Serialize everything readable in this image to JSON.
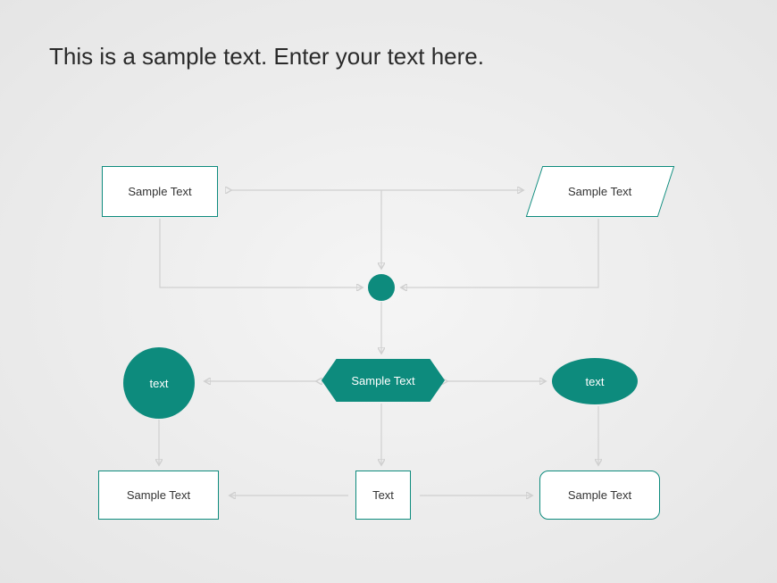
{
  "title": "This is a sample text. Enter your text here.",
  "nodes": {
    "top_left_rect": "Sample Text",
    "top_right_para": "Sample Text",
    "center_circle": "",
    "left_circle": "text",
    "center_hex": "Sample Text",
    "right_ellipse": "text",
    "bottom_left_rect": "Sample Text",
    "bottom_mid_rect": "Text",
    "bottom_right_rrect": "Sample Text"
  },
  "colors": {
    "accent": "#0d8b7d",
    "connector": "#d0d0d0",
    "text": "#333333"
  }
}
